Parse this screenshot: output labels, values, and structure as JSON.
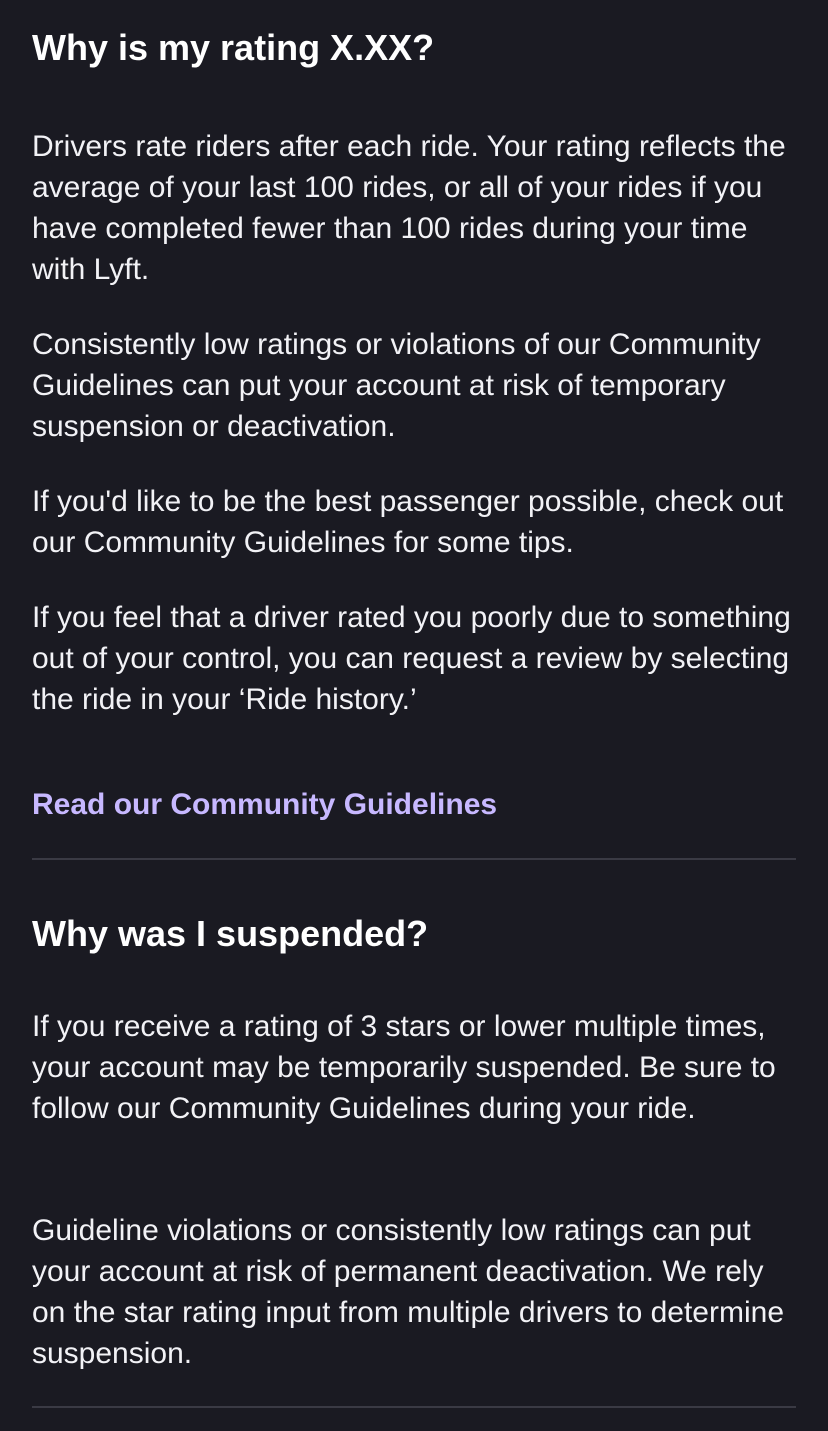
{
  "sections": [
    {
      "heading": "Why is my rating X.XX?",
      "paragraphs": [
        "Drivers rate riders after each ride. Your rating reflects the average of your last 100 rides, or all of your rides if you have completed fewer than 100 rides during your time with Lyft.",
        "Consistently low ratings or violations of our Community Guidelines can put your account at risk of temporary suspension or deactivation.",
        "If you'd like to be the best passenger possible, check out our Community Guidelines for some tips.",
        "If you feel that a driver rated you poorly due to something out of your control, you can request a review by selecting the ride in your ‘Ride history.’"
      ],
      "link_label": "Read our Community Guidelines"
    },
    {
      "heading": "Why was I suspended?",
      "paragraphs": [
        "If you receive a rating of 3 stars or lower multiple times, your account may be temporarily suspended. Be sure to follow our Community Guidelines during your ride.",
        "Guideline violations or consistently low ratings can put your account at risk of permanent deactivation. We rely on the star rating input from multiple drivers to determine suspension."
      ]
    }
  ],
  "colors": {
    "background": "#1a1a22",
    "link": "#c7b8ff",
    "divider": "#3a3a44"
  }
}
